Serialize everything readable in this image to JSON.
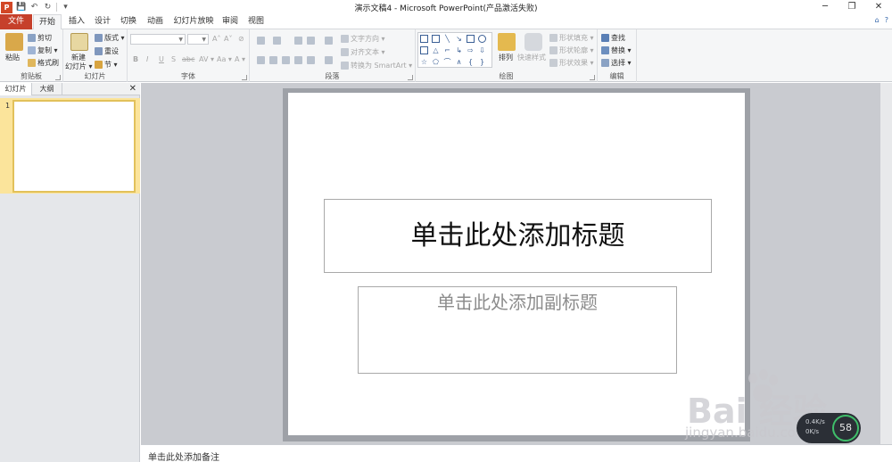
{
  "window": {
    "title": "演示文稿4 - Microsoft PowerPoint(产品激活失败)",
    "app_logo": "P"
  },
  "qat": {
    "save": "💾",
    "undo": "↶",
    "redo": "↻",
    "customize": "▾"
  },
  "window_controls": {
    "minimize": "─",
    "restore": "❐",
    "close": "✕"
  },
  "tabs": [
    {
      "label": "文件"
    },
    {
      "label": "开始"
    },
    {
      "label": "插入"
    },
    {
      "label": "设计"
    },
    {
      "label": "切换"
    },
    {
      "label": "动画"
    },
    {
      "label": "幻灯片放映"
    },
    {
      "label": "审阅"
    },
    {
      "label": "视图"
    }
  ],
  "tab_right": {
    "collapse": "⌂",
    "help": "?"
  },
  "ribbon": {
    "clipboard": {
      "label": "剪贴板",
      "paste": "粘贴",
      "cut": "剪切",
      "copy": "复制 ▾",
      "format_painter": "格式刷"
    },
    "slides": {
      "label": "幻灯片",
      "new_slide": "新建",
      "new_slide2": "幻灯片 ▾",
      "layout": "版式 ▾",
      "reset": "重设",
      "section": "节 ▾"
    },
    "font": {
      "label": "字体",
      "bold": "B",
      "italic": "I",
      "underline": "U",
      "strike": "S",
      "shadow": "abc",
      "spacing": "AV ▾",
      "case": "Aa ▾",
      "color": "A ▾",
      "grow": "A˄",
      "shrink": "A˅",
      "clear": "⊘"
    },
    "paragraph": {
      "label": "段落",
      "text_direction": "文字方向 ▾",
      "align_text": "对齐文本 ▾",
      "smartart": "转换为 SmartArt ▾"
    },
    "drawing": {
      "label": "绘图",
      "arrange": "排列",
      "quick_styles": "快速样式",
      "shape_fill": "形状填充 ▾",
      "shape_outline": "形状轮廓 ▾",
      "shape_effects": "形状效果 ▾"
    },
    "editing": {
      "label": "编辑",
      "find": "查找",
      "replace": "替换 ▾",
      "select": "选择 ▾"
    }
  },
  "left_pane": {
    "tab_slides": "幻灯片",
    "tab_outline": "大纲",
    "close": "✕",
    "slide_number": "1"
  },
  "slide": {
    "title_placeholder": "单击此处添加标题",
    "subtitle_placeholder": "单击此处添加副标题"
  },
  "notes": {
    "placeholder": "单击此处添加备注"
  },
  "watermark": {
    "text": "Bai  经验",
    "url": "jingyan.baidu.com"
  },
  "speed_widget": {
    "up": "0.4K/s",
    "down": "0K/s",
    "percent": "58"
  },
  "colors": {
    "file_tab": "#c6402b",
    "thumb_highlight": "#fbe49b"
  }
}
